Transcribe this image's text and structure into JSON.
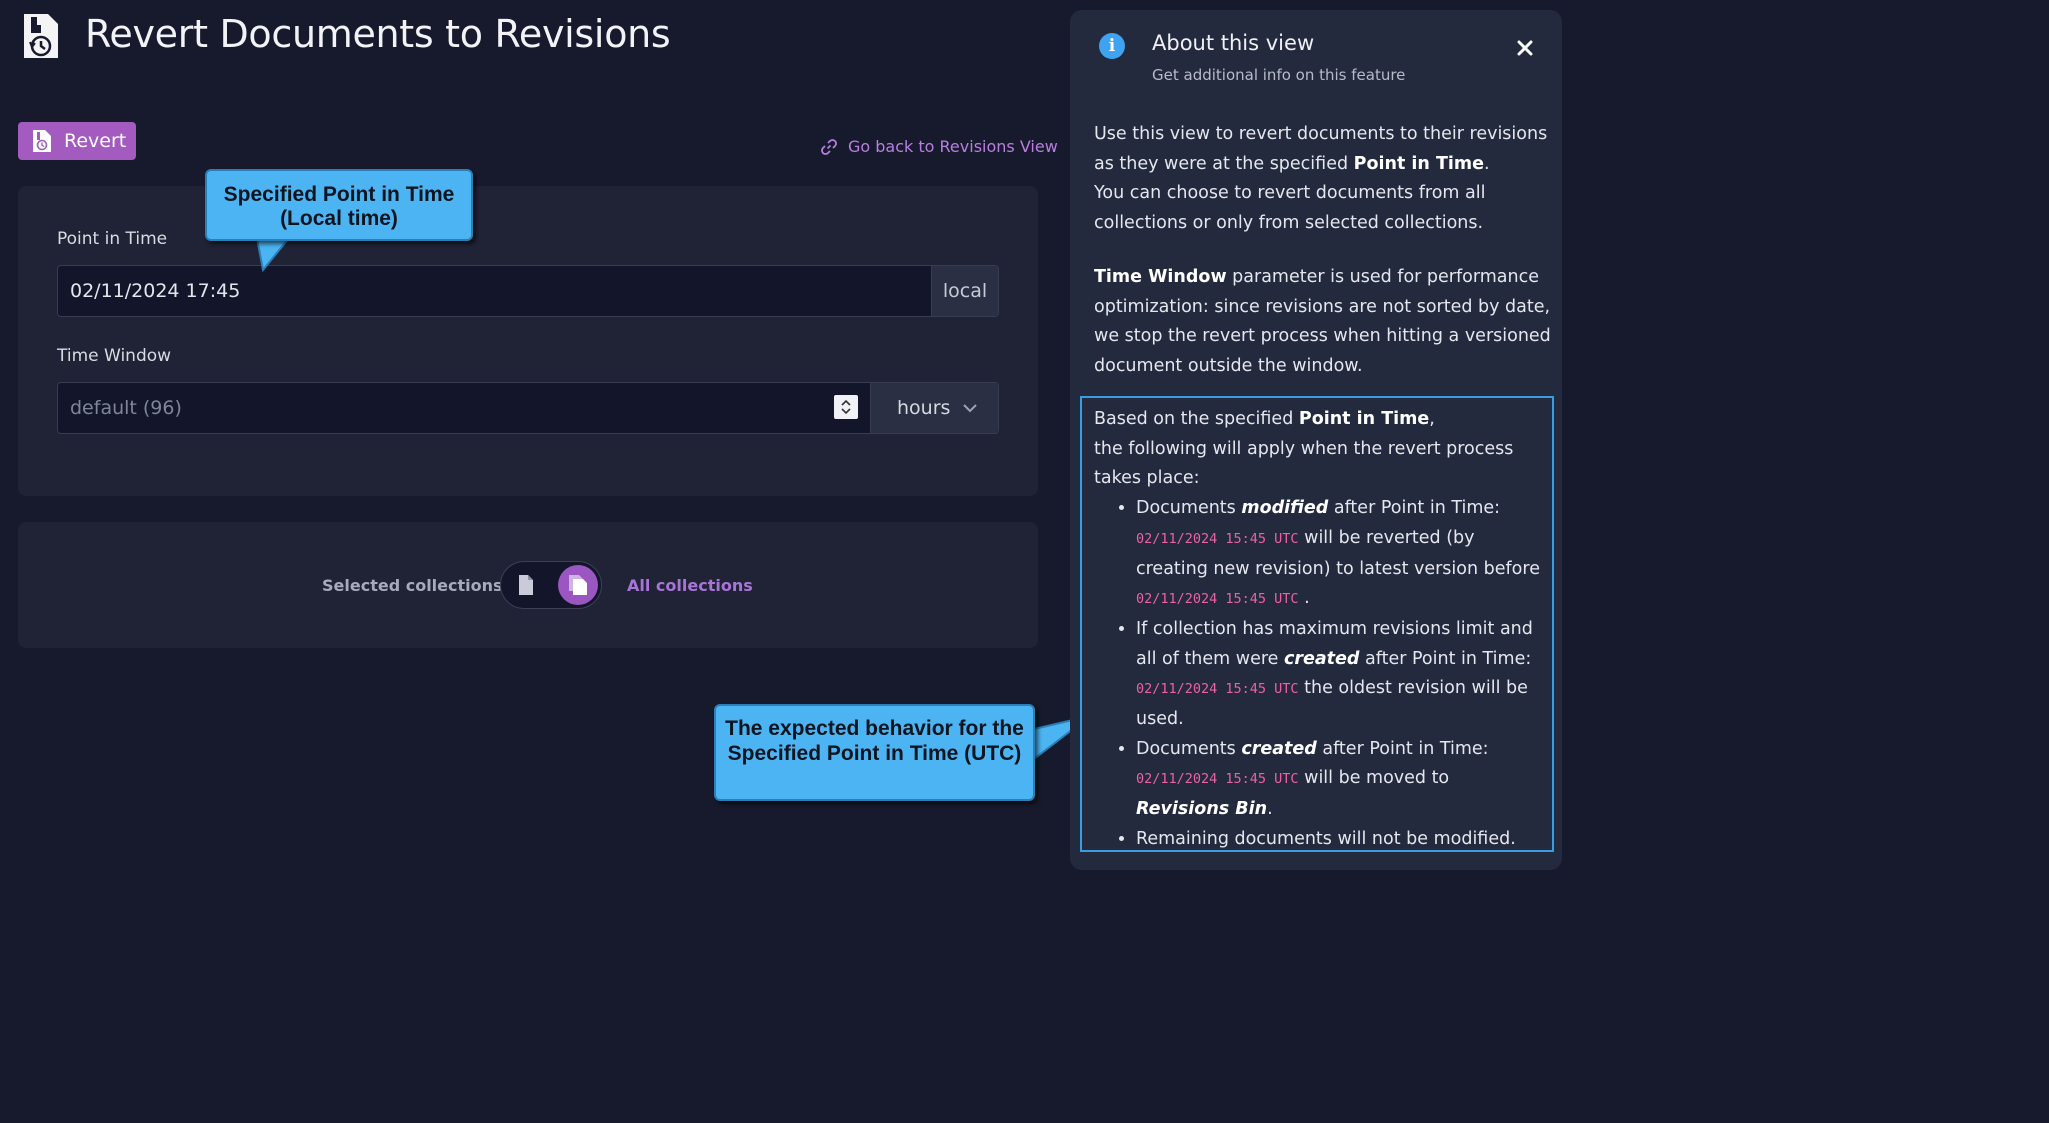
{
  "header": {
    "title": "Revert Documents to Revisions",
    "icon": "revert-document-icon"
  },
  "toolbar": {
    "revert_label": "Revert",
    "back_link_label": "Go back to Revisions View"
  },
  "form": {
    "point_in_time": {
      "label": "Point in Time",
      "value": "02/11/2024 17:45",
      "addon": "local"
    },
    "time_window": {
      "label": "Time Window",
      "placeholder": "default (96)",
      "unit": "hours"
    }
  },
  "collections_toggle": {
    "left_label": "Selected collections",
    "right_label": "All collections",
    "selected": "All collections"
  },
  "annotations": {
    "callout_point_in_time": "Specified Point in Time (Local time)",
    "callout_expected_behavior": "The expected behavior for the Specified Point in Time (UTC)"
  },
  "about": {
    "title": "About this view",
    "subtitle": "Get additional info on this feature",
    "p1_a": "Use this view to revert documents to their revisions as they were at the specified ",
    "p1_b": "Point in Time",
    "p1_c": ".",
    "p2": "You can choose to revert documents from all collections or only from selected collections.",
    "p3_a": "Time Window",
    "p3_b": " parameter is used for performance optimization: since revisions are not sorted by date, we stop the revert process when hitting a versioned document outside the window.",
    "box_intro_a": "Based on the specified ",
    "box_intro_b": "Point in Time",
    "box_intro_c": ",",
    "box_intro_d": "the following will apply when the revert process takes place:",
    "utc_time": "02/11/2024 15:45 UTC",
    "items": [
      {
        "a": "Documents ",
        "b": "modified",
        "c": " after Point in Time:",
        "d": " will be reverted (by creating new revision) to latest version before ",
        "e": " ."
      },
      {
        "a": "If collection has maximum revisions limit and all of them were ",
        "b": "created",
        "c": " after Point in Time:",
        "d": " the oldest revision will be used."
      },
      {
        "a": "Documents ",
        "b": "created",
        "c": " after Point in Time:",
        "d": " will be moved to ",
        "e": "Revisions Bin",
        "f": "."
      },
      {
        "a": "Remaining documents will not be modified."
      }
    ]
  },
  "colors": {
    "background": "#171a2c",
    "panel": "#1f2335",
    "accent_purple": "#a35bc0",
    "callout_blue": "#4cb4f2",
    "highlight_border": "#3d9be0",
    "code_pink": "#ef5fa7"
  }
}
